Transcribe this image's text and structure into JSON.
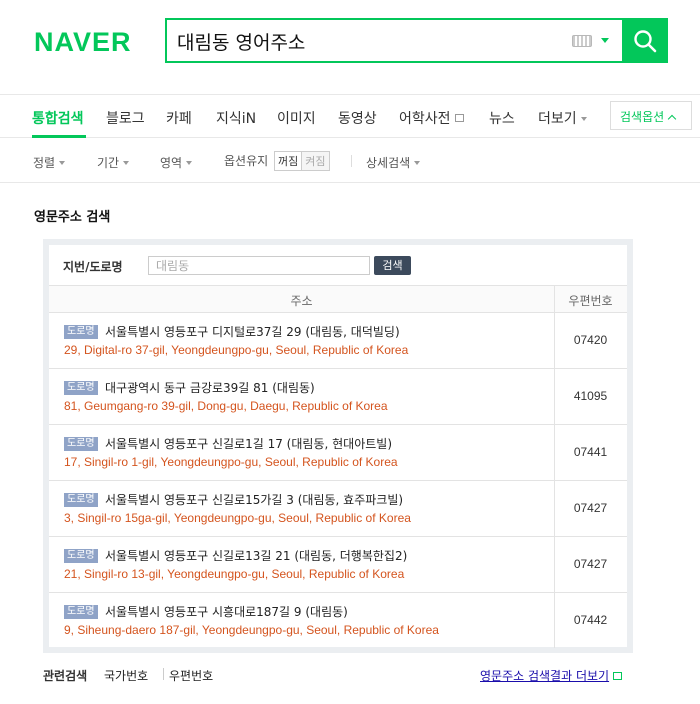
{
  "header": {
    "logo": "NAVER",
    "query": "대림동 영어주소"
  },
  "nav": {
    "tabs": [
      {
        "label": "통합검색",
        "active": true
      },
      {
        "label": "블로그"
      },
      {
        "label": "카페"
      },
      {
        "label": "지식iN"
      },
      {
        "label": "이미지"
      },
      {
        "label": "동영상"
      },
      {
        "label": "어학사전"
      },
      {
        "label": "뉴스"
      },
      {
        "label": "더보기"
      }
    ],
    "search_options": "검색옵션"
  },
  "filters": {
    "sort": "정렬",
    "period": "기간",
    "area": "영역",
    "keep_options": "옵션유지",
    "off": "꺼짐",
    "on": "켜짐",
    "advanced": "상세검색"
  },
  "section": {
    "title": "영문주소 검색",
    "search_label": "지번/도로명",
    "search_placeholder": "대림동",
    "search_button": "검색",
    "col_address": "주소",
    "col_zip": "우편번호",
    "badge": "도로명",
    "rows": [
      {
        "kr": "서울특별시 영등포구 디지털로37길 29 (대림동, 대덕빌딩)",
        "en": "29, Digital-ro 37-gil, Yeongdeungpo-gu, Seoul, Republic of Korea",
        "zip": "07420"
      },
      {
        "kr": "대구광역시 동구 금강로39길 81 (대림동)",
        "en": "81, Geumgang-ro 39-gil, Dong-gu, Daegu, Republic of Korea",
        "zip": "41095"
      },
      {
        "kr": "서울특별시 영등포구 신길로1길 17 (대림동, 현대아트빌)",
        "en": "17, Singil-ro 1-gil, Yeongdeungpo-gu, Seoul, Republic of Korea",
        "zip": "07441"
      },
      {
        "kr": "서울특별시 영등포구 신길로15가길 3 (대림동, 효주파크빌)",
        "en": "3, Singil-ro 15ga-gil, Yeongdeungpo-gu, Seoul, Republic of Korea",
        "zip": "07427"
      },
      {
        "kr": "서울특별시 영등포구 신길로13길 21 (대림동, 더행복한집2)",
        "en": "21, Singil-ro 13-gil, Yeongdeungpo-gu, Seoul, Republic of Korea",
        "zip": "07427"
      },
      {
        "kr": "서울특별시 영등포구 시흥대로187길 9 (대림동)",
        "en": "9, Siheung-daero 187-gil, Yeongdeungpo-gu, Seoul, Republic of Korea",
        "zip": "07442"
      }
    ]
  },
  "footer": {
    "related_label": "관련검색",
    "related": [
      "국가번호",
      "우편번호"
    ],
    "more": "영문주소 검색결과 더보기"
  },
  "colors": {
    "brand": "#03c75a",
    "english_address": "#d4541e",
    "badge": "#8fa3c7"
  }
}
